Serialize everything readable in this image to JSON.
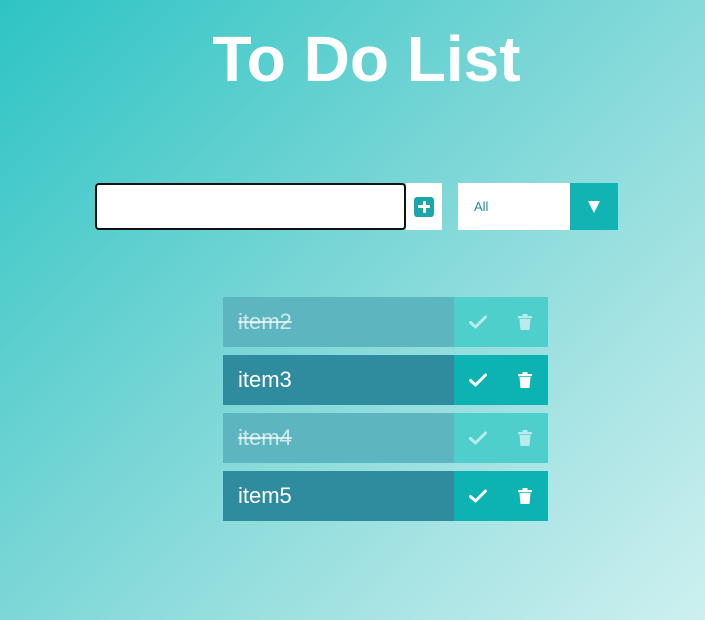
{
  "header": {
    "title": "To Do List"
  },
  "form": {
    "input_value": "",
    "add_icon": "plus-square-icon",
    "filter": {
      "selected": "All",
      "arrow_icon": "triangle-down-icon"
    }
  },
  "todos": [
    {
      "text": "item2",
      "completed": true
    },
    {
      "text": "item3",
      "completed": false
    },
    {
      "text": "item4",
      "completed": true
    },
    {
      "text": "item5",
      "completed": false
    }
  ],
  "colors": {
    "accent": "#12b3b3",
    "item_bg": "#2e8c9e",
    "item_bg_completed": "#5db6bf"
  }
}
